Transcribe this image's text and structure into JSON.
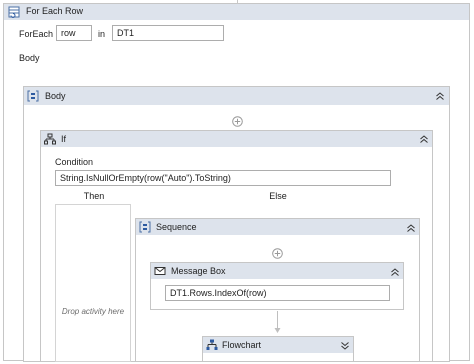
{
  "foreach": {
    "title": "For Each Row",
    "foreach_label": "ForEach",
    "item_value": "row",
    "in_label": "in",
    "collection_value": "DT1",
    "body_label": "Body"
  },
  "body_scope": {
    "title": "Body"
  },
  "if_activity": {
    "title": "If",
    "condition_label": "Condition",
    "condition_value": "String.IsNullOrEmpty(row(\"Auto\").ToString)",
    "then_label": "Then",
    "else_label": "Else",
    "drop_hint": "Drop activity here"
  },
  "sequence": {
    "title": "Sequence"
  },
  "message_box": {
    "title": "Message Box",
    "text_value": "DT1.Rows.IndexOf(row)"
  },
  "flowchart": {
    "title": "Flowchart"
  },
  "colors": {
    "header_bg": "#dde3ec",
    "border": "#c6c6c6",
    "icon_blue": "#2d5aa0"
  }
}
